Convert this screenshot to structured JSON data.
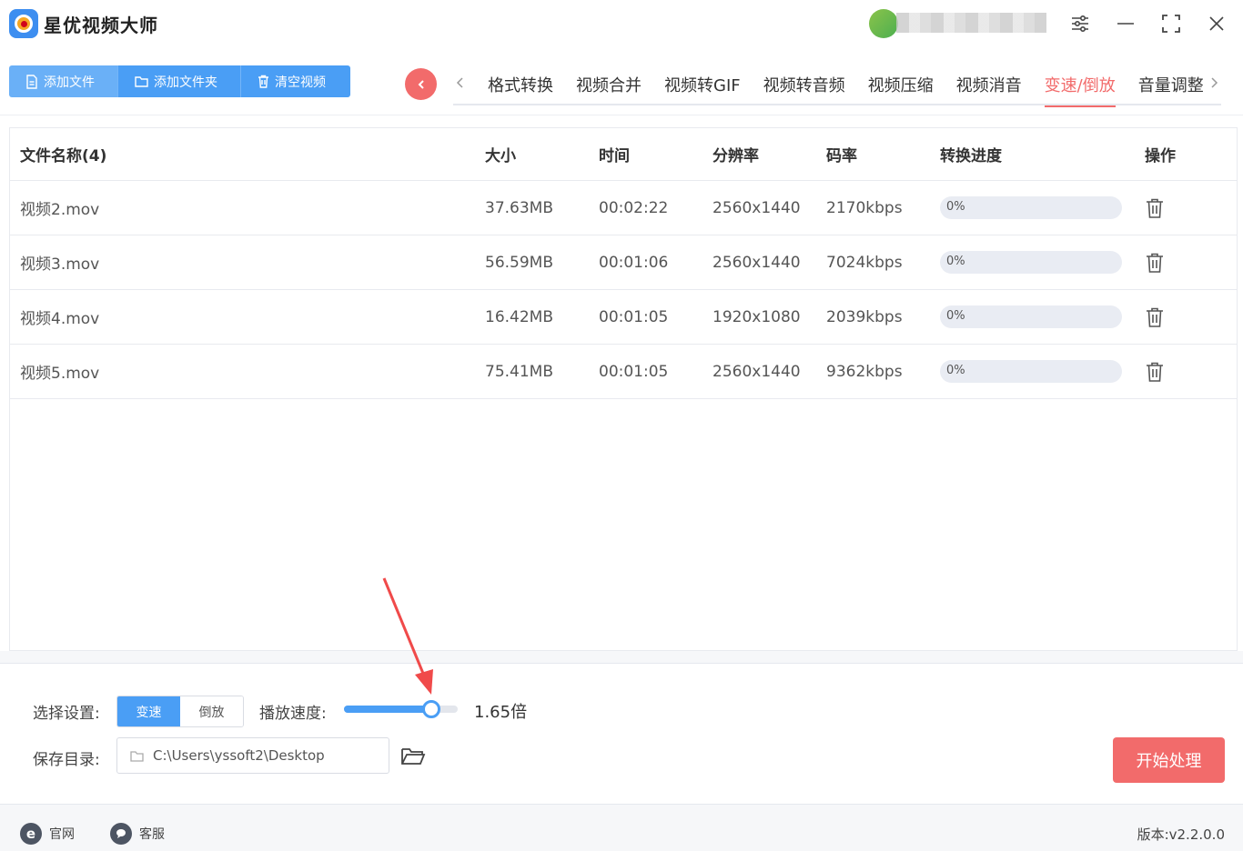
{
  "app": {
    "title": "星优视频大师"
  },
  "toolbar": {
    "add_file": "添加文件",
    "add_folder": "添加文件夹",
    "clear_videos": "清空视频"
  },
  "tabs": [
    {
      "label": "格式转换",
      "active": false
    },
    {
      "label": "视频合并",
      "active": false
    },
    {
      "label": "视频转GIF",
      "active": false
    },
    {
      "label": "视频转音频",
      "active": false
    },
    {
      "label": "视频压缩",
      "active": false
    },
    {
      "label": "视频消音",
      "active": false
    },
    {
      "label": "变速/倒放",
      "active": true
    },
    {
      "label": "音量调整",
      "active": false
    }
  ],
  "table": {
    "headers": {
      "name": "文件名称(4)",
      "size": "大小",
      "time": "时间",
      "resolution": "分辨率",
      "bitrate": "码率",
      "progress": "转换进度",
      "action": "操作"
    },
    "rows": [
      {
        "name": "视频2.mov",
        "size": "37.63MB",
        "time": "00:02:22",
        "resolution": "2560x1440",
        "bitrate": "2170kbps",
        "progress_text": "0%",
        "progress": 0
      },
      {
        "name": "视频3.mov",
        "size": "56.59MB",
        "time": "00:01:06",
        "resolution": "2560x1440",
        "bitrate": "7024kbps",
        "progress_text": "0%",
        "progress": 0
      },
      {
        "name": "视频4.mov",
        "size": "16.42MB",
        "time": "00:01:05",
        "resolution": "1920x1080",
        "bitrate": "2039kbps",
        "progress_text": "0%",
        "progress": 0
      },
      {
        "name": "视频5.mov",
        "size": "75.41MB",
        "time": "00:01:05",
        "resolution": "2560x1440",
        "bitrate": "9362kbps",
        "progress_text": "0%",
        "progress": 0
      }
    ]
  },
  "settings": {
    "select_label": "选择设置:",
    "mode_speed": "变速",
    "mode_reverse": "倒放",
    "selected_mode": "变速",
    "speed_label": "播放速度:",
    "speed_value_text": "1.65倍",
    "speed_slider_fraction": 0.77,
    "save_label": "保存目录:",
    "save_path": "C:\\Users\\yssoft2\\Desktop",
    "start_button": "开始处理"
  },
  "status": {
    "website": "官网",
    "support": "客服",
    "version": "版本:v2.2.0.0"
  },
  "colors": {
    "primary": "#4a9ef5",
    "accent": "#f26b6b"
  }
}
